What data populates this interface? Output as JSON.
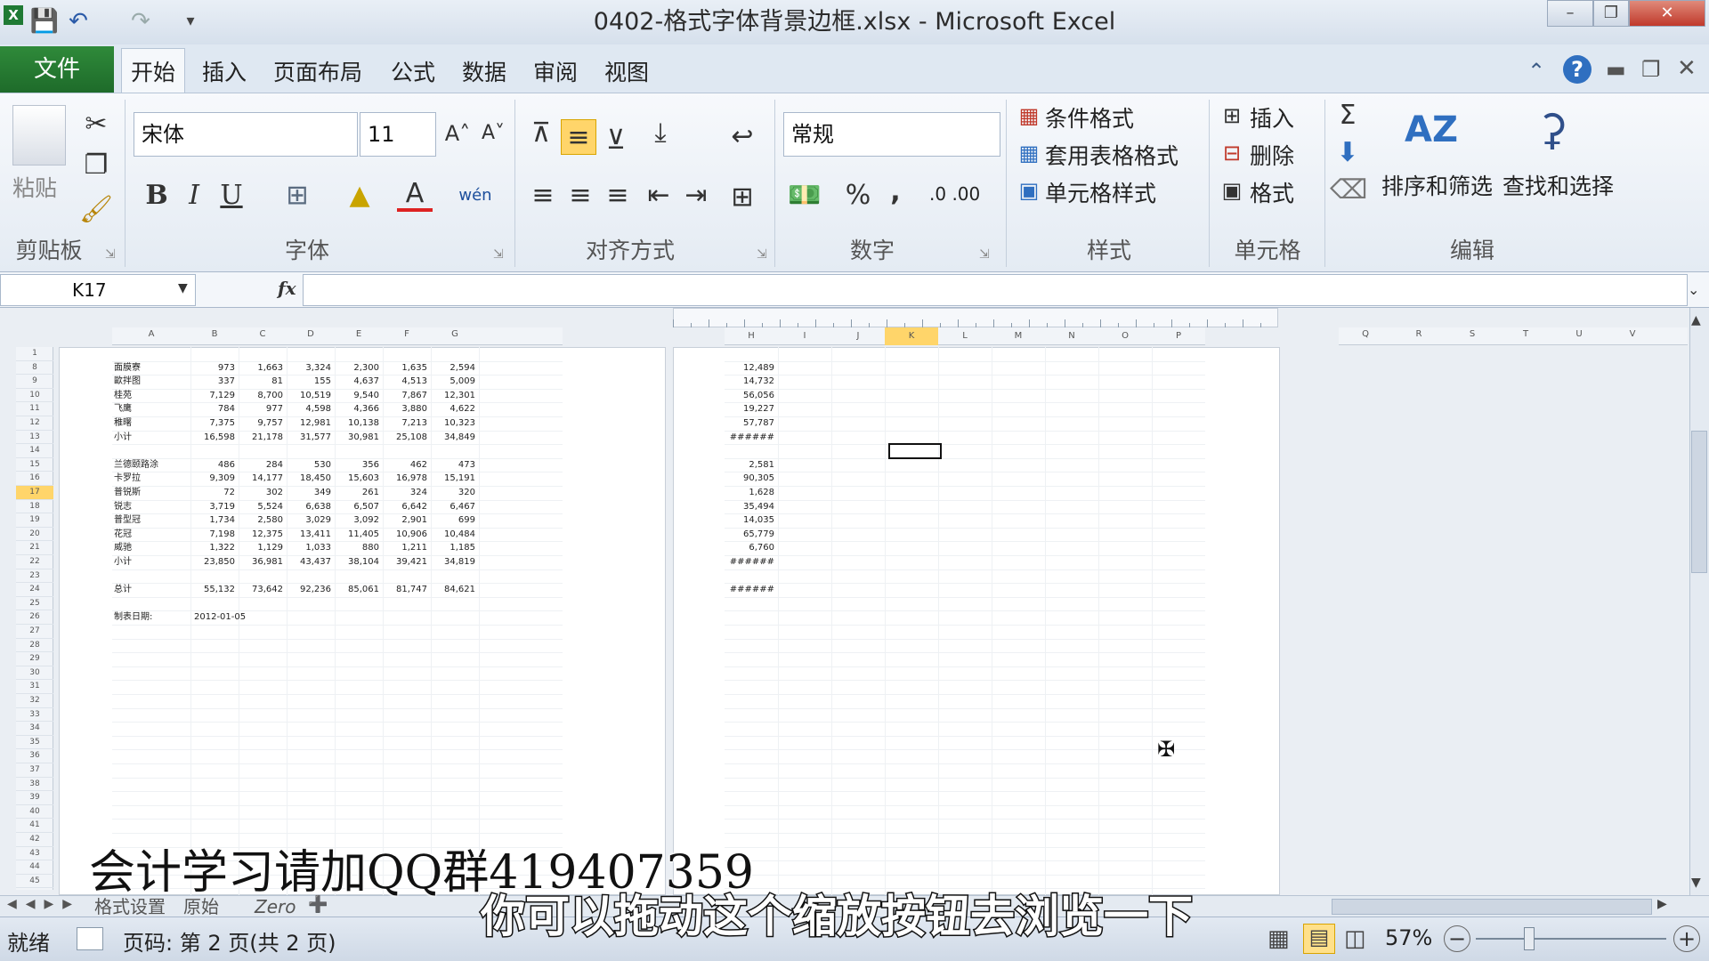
{
  "window": {
    "title": "0402-格式字体背景边框.xlsx - Microsoft Excel",
    "minimize": "–",
    "restore": "❐",
    "close": "✕"
  },
  "tabs": {
    "file": "文件",
    "items": [
      "开始",
      "插入",
      "页面布局",
      "公式",
      "数据",
      "审阅",
      "视图"
    ]
  },
  "ribbon": {
    "clipboard": {
      "paste": "粘贴",
      "group": "剪贴板"
    },
    "font": {
      "name": "宋体",
      "size": "11",
      "bold": "B",
      "italic": "I",
      "underline": "U",
      "color": "A",
      "phonetic": "wén",
      "grow": "A˄",
      "shrink": "A˅",
      "group": "字体"
    },
    "alignment": {
      "group": "对齐方式"
    },
    "number": {
      "format": "常规",
      "percent": "%",
      "comma": ",",
      "inc": ".0 .00",
      "group": "数字"
    },
    "styles": {
      "conditional": "条件格式",
      "table": "套用表格格式",
      "cell": "单元格样式",
      "group": "样式"
    },
    "cells": {
      "insert": "插入",
      "delete": "删除",
      "format": "格式",
      "group": "单元格"
    },
    "editing": {
      "sum": "Σ",
      "sort": "排序和筛选",
      "find": "查找和选择",
      "group": "编辑"
    }
  },
  "formula_bar": {
    "name_box": "K17",
    "fx": "fx",
    "value": ""
  },
  "sheet": {
    "left_cols": [
      "A",
      "B",
      "C",
      "D",
      "E",
      "F",
      "G"
    ],
    "right_cols": [
      "H",
      "I",
      "J",
      "K",
      "L",
      "M",
      "N",
      "O",
      "P"
    ],
    "far_cols": [
      "Q",
      "R",
      "S",
      "T",
      "U",
      "V"
    ],
    "rows": [
      {
        "label": "面膜寮",
        "vals": [
          "973",
          "1,663",
          "3,324",
          "2,300",
          "1,635",
          "2,594"
        ],
        "h": "12,489"
      },
      {
        "label": "歐拌图",
        "vals": [
          "337",
          "81",
          "155",
          "4,637",
          "4,513",
          "5,009"
        ],
        "h": "14,732"
      },
      {
        "label": "桂苑",
        "vals": [
          "7,129",
          "8,700",
          "10,519",
          "9,540",
          "7,867",
          "12,301"
        ],
        "h": "56,056"
      },
      {
        "label": "飞鹰",
        "vals": [
          "784",
          "977",
          "4,598",
          "4,366",
          "3,880",
          "4,622"
        ],
        "h": "19,227"
      },
      {
        "label": "稚曙",
        "vals": [
          "7,375",
          "9,757",
          "12,981",
          "10,138",
          "7,213",
          "10,323"
        ],
        "h": "57,787"
      },
      {
        "label": "小计",
        "vals": [
          "16,598",
          "21,178",
          "31,577",
          "30,981",
          "25,108",
          "34,849"
        ],
        "h": "######"
      },
      {
        "label": "",
        "vals": [
          "",
          "",
          "",
          "",
          "",
          ""
        ],
        "h": ""
      },
      {
        "label": "兰德颐路涂",
        "vals": [
          "486",
          "284",
          "530",
          "356",
          "462",
          "473"
        ],
        "h": "2,581"
      },
      {
        "label": "卡罗拉",
        "vals": [
          "9,309",
          "14,177",
          "18,450",
          "15,603",
          "16,978",
          "15,191"
        ],
        "h": "90,305"
      },
      {
        "label": "普锐斯",
        "vals": [
          "72",
          "302",
          "349",
          "261",
          "324",
          "320"
        ],
        "h": "1,628"
      },
      {
        "label": "锐志",
        "vals": [
          "3,719",
          "5,524",
          "6,638",
          "6,507",
          "6,642",
          "6,467"
        ],
        "h": "35,494"
      },
      {
        "label": "普型冠",
        "vals": [
          "1,734",
          "2,580",
          "3,029",
          "3,092",
          "2,901",
          "699"
        ],
        "h": "14,035"
      },
      {
        "label": "花冠",
        "vals": [
          "7,198",
          "12,375",
          "13,411",
          "11,405",
          "10,906",
          "10,484"
        ],
        "h": "65,779"
      },
      {
        "label": "威驰",
        "vals": [
          "1,322",
          "1,129",
          "1,033",
          "880",
          "1,211",
          "1,185"
        ],
        "h": "6,760"
      },
      {
        "label": "小计",
        "vals": [
          "23,850",
          "36,981",
          "43,437",
          "38,104",
          "39,421",
          "34,819"
        ],
        "h": "######"
      },
      {
        "label": "",
        "vals": [
          "",
          "",
          "",
          "",
          "",
          ""
        ],
        "h": ""
      },
      {
        "label": "总计",
        "vals": [
          "55,132",
          "73,642",
          "92,236",
          "85,061",
          "81,747",
          "84,621"
        ],
        "h": "######"
      }
    ],
    "date_label": "制表日期:",
    "date_value": "2012-01-05"
  },
  "sheet_tabs": [
    "格式设置",
    "原始",
    "Zero"
  ],
  "status": {
    "ready": "就绪",
    "page": "页码: 第 2 页(共 2 页)",
    "zoom": "57%"
  },
  "overlay": {
    "watermark": "会计学习请加QQ群419407359",
    "caption": "你可以拖动这个缩放按钮去浏览一下"
  }
}
